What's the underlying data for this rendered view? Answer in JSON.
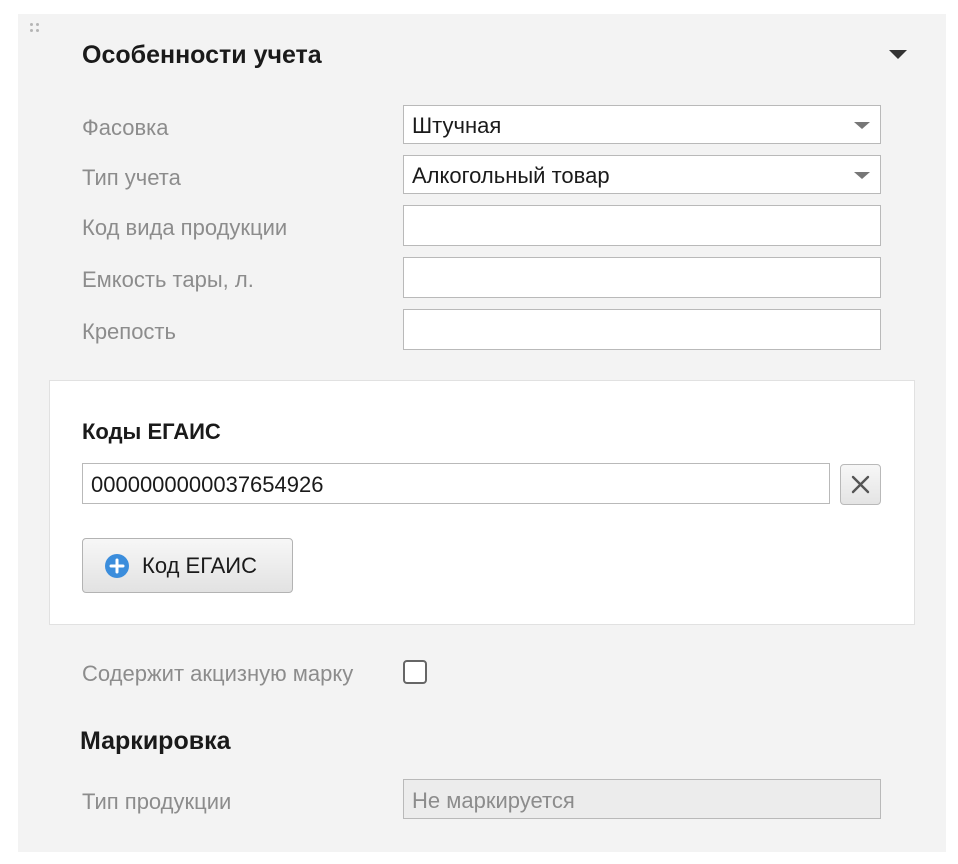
{
  "section": {
    "title": "Особенности учета"
  },
  "fields": {
    "packaging": {
      "label": "Фасовка",
      "value": "Штучная"
    },
    "accounting_type": {
      "label": "Тип учета",
      "value": "Алкогольный товар"
    },
    "product_kind_code": {
      "label": "Код вида продукции",
      "value": ""
    },
    "container_volume": {
      "label": "Емкость тары, л.",
      "value": ""
    },
    "strength": {
      "label": "Крепость",
      "value": ""
    }
  },
  "egais": {
    "title": "Коды ЕГАИС",
    "codes": [
      "0000000000037654926"
    ],
    "add_button_label": "Код ЕГАИС"
  },
  "excise": {
    "label": "Содержит акцизную марку",
    "checked": false
  },
  "marking": {
    "title": "Маркировка",
    "product_type_label": "Тип продукции",
    "product_type_value": "Не маркируется"
  },
  "icons": {
    "drag": "drag-handle-icon",
    "collapse": "triangle-down-icon",
    "dropdown": "chevron-down-icon",
    "remove": "close-icon",
    "add": "plus-circle-icon"
  },
  "colors": {
    "panel_background": "#f3f3f3",
    "label_text": "#8c8c8c",
    "add_icon": "#3b8ddc"
  }
}
